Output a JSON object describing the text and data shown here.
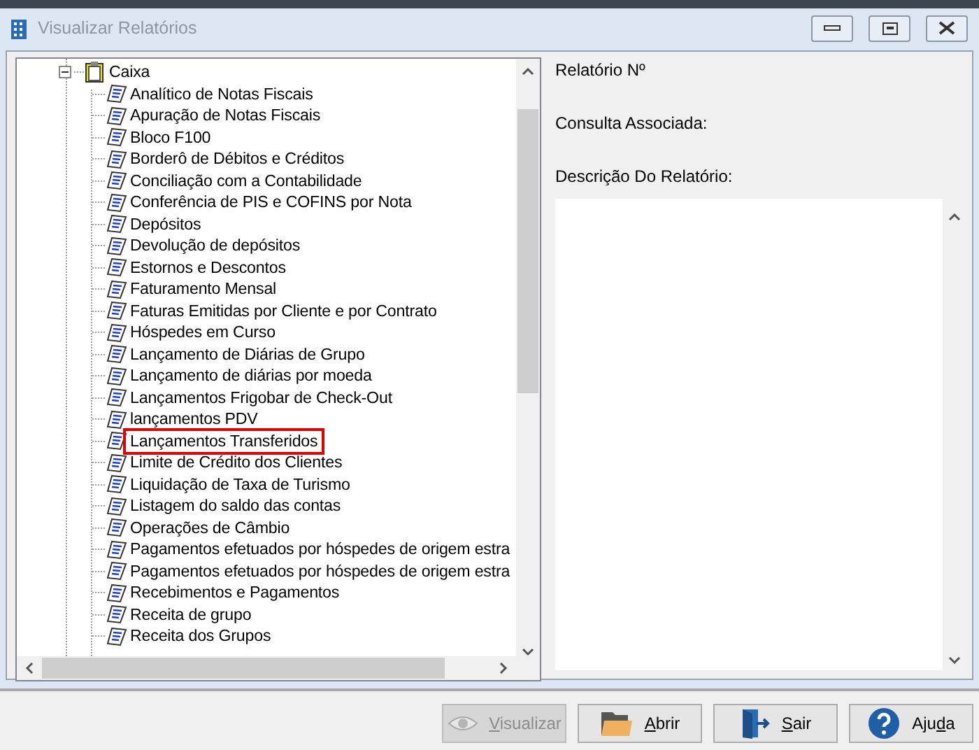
{
  "window": {
    "title": "Visualizar Relatórios"
  },
  "tree": {
    "label": "Caixa",
    "expanded": true,
    "children": [
      {
        "label": "Analítico de Notas Fiscais",
        "highlighted": false
      },
      {
        "label": "Apuração de Notas Fiscais",
        "highlighted": false
      },
      {
        "label": "Bloco F100",
        "highlighted": false
      },
      {
        "label": "Borderô de Débitos e Créditos",
        "highlighted": false
      },
      {
        "label": "Conciliação com a Contabilidade",
        "highlighted": false
      },
      {
        "label": "Conferência de PIS e COFINS por Nota",
        "highlighted": false
      },
      {
        "label": "Depósitos",
        "highlighted": false
      },
      {
        "label": "Devolução de depósitos",
        "highlighted": false
      },
      {
        "label": "Estornos e Descontos",
        "highlighted": false
      },
      {
        "label": "Faturamento Mensal",
        "highlighted": false
      },
      {
        "label": "Faturas Emitidas por Cliente e por Contrato",
        "highlighted": false
      },
      {
        "label": "Hóspedes em Curso",
        "highlighted": false
      },
      {
        "label": "Lançamento de Diárias de Grupo",
        "highlighted": false
      },
      {
        "label": "Lançamento de diárias por moeda",
        "highlighted": false
      },
      {
        "label": "Lançamentos Frigobar de Check-Out",
        "highlighted": false
      },
      {
        "label": "lançamentos PDV",
        "highlighted": false
      },
      {
        "label": "Lançamentos Transferidos",
        "highlighted": true
      },
      {
        "label": "Limite de Crédito dos Clientes",
        "highlighted": false
      },
      {
        "label": "Liquidação de Taxa de Turismo",
        "highlighted": false
      },
      {
        "label": "Listagem do saldo das contas",
        "highlighted": false
      },
      {
        "label": "Operações de Câmbio",
        "highlighted": false
      },
      {
        "label": "Pagamentos efetuados por hóspedes de origem estra",
        "highlighted": false
      },
      {
        "label": "Pagamentos efetuados por hóspedes de origem estra",
        "highlighted": false
      },
      {
        "label": "Recebimentos e Pagamentos",
        "highlighted": false
      },
      {
        "label": "Receita de grupo",
        "highlighted": false
      },
      {
        "label": "Receita dos Grupos",
        "highlighted": false
      }
    ]
  },
  "details": {
    "fields": [
      "Relatório Nº",
      "Consulta Associada:",
      "Descrição Do Relatório:"
    ]
  },
  "buttons": [
    {
      "kind": "view",
      "key": "V",
      "post": "isualizar",
      "disabled": true
    },
    {
      "kind": "open",
      "key": "A",
      "post": "brir",
      "disabled": false
    },
    {
      "kind": "exit",
      "key": "S",
      "post": "air",
      "disabled": false
    },
    {
      "kind": "help",
      "pre": "Aju",
      "key": "d",
      "post": "a",
      "disabled": false
    }
  ]
}
